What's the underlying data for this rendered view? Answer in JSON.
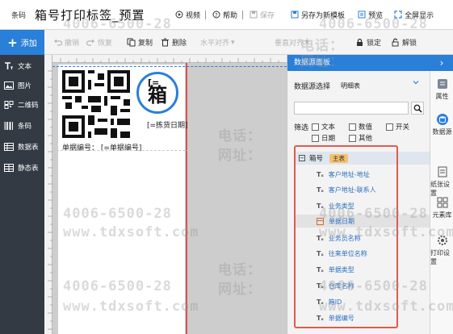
{
  "window": {
    "app_label": "条码",
    "title": "箱号打印标签_预置"
  },
  "title_actions": [
    {
      "label": "视频",
      "icon": "video-icon",
      "enabled": true
    },
    {
      "label": "帮助",
      "icon": "help-icon",
      "enabled": true
    },
    {
      "label": "保存",
      "icon": "save-icon",
      "enabled": false
    },
    {
      "label": "另存为新模板",
      "icon": "save-as-icon",
      "enabled": true
    },
    {
      "label": "预览",
      "icon": "preview-icon",
      "enabled": true
    },
    {
      "label": "全屏显示",
      "icon": "fullscreen-icon",
      "enabled": true
    }
  ],
  "toolbar": {
    "add_label": "添加",
    "undo": "撤销",
    "redo": "恢复",
    "copy": "复制",
    "delete": "删除",
    "h_align": "水平对齐",
    "v_align": "垂直对齐",
    "lock": "锁定",
    "unlock": "解锁"
  },
  "sidebar": {
    "items": [
      {
        "label": "文本",
        "icon": "text-icon"
      },
      {
        "label": "图片",
        "icon": "image-icon"
      },
      {
        "label": "二维码",
        "icon": "qrcode-icon"
      },
      {
        "label": "条码",
        "icon": "barcode-icon"
      },
      {
        "label": "数据表",
        "icon": "data-table-icon"
      },
      {
        "label": "静态表",
        "icon": "static-table-icon"
      }
    ]
  },
  "canvas": {
    "circle_char": "箱",
    "circle_mark": "[=",
    "date_field": "[=拣货日期]",
    "doc_field": "单据编号：  [=单据编号]"
  },
  "panel": {
    "header": "数据源面板",
    "datasource_label": "数据源选择",
    "datasource_value": "明细表",
    "search_placeholder": "",
    "filter_label": "筛选",
    "filters": [
      {
        "label": "文本",
        "checked": false
      },
      {
        "label": "数值",
        "checked": false
      },
      {
        "label": "开关",
        "checked": false
      },
      {
        "label": "日期",
        "checked": false
      },
      {
        "label": "其他",
        "checked": false
      }
    ],
    "root": {
      "label": "箱号",
      "badge": "主表"
    },
    "fields": [
      {
        "label": "客户地址-地址",
        "type": "text"
      },
      {
        "label": "客户地址-联系人",
        "type": "text"
      },
      {
        "label": "业务类型",
        "type": "text"
      },
      {
        "label": "单据日期",
        "type": "date",
        "selected": true
      },
      {
        "label": "业务员名称",
        "type": "text"
      },
      {
        "label": "往来单位名称",
        "type": "text"
      },
      {
        "label": "单据类型",
        "type": "text"
      },
      {
        "label": "仓库名称",
        "type": "text"
      },
      {
        "label": "箱ID",
        "type": "text"
      },
      {
        "label": "单据编号",
        "type": "text"
      }
    ]
  },
  "rail": {
    "items": [
      {
        "label": "属性",
        "icon": "properties-icon"
      },
      {
        "label": "数据源",
        "icon": "datasource-icon"
      },
      {
        "label": "纸张设置",
        "icon": "paper-icon"
      },
      {
        "label": "元素库",
        "icon": "element-library-icon"
      },
      {
        "label": "打印设置",
        "icon": "print-settings-icon"
      }
    ]
  },
  "watermark": {
    "phone": "电话：",
    "number": "4006-6500-28",
    "site_label": "网址：",
    "site": "www.tdxsoft.com"
  },
  "colors": {
    "accent": "#2a7fd8",
    "sidebar_bg": "#333a44",
    "highlight_border": "#e05a4f",
    "badge": "#f5c16c"
  }
}
